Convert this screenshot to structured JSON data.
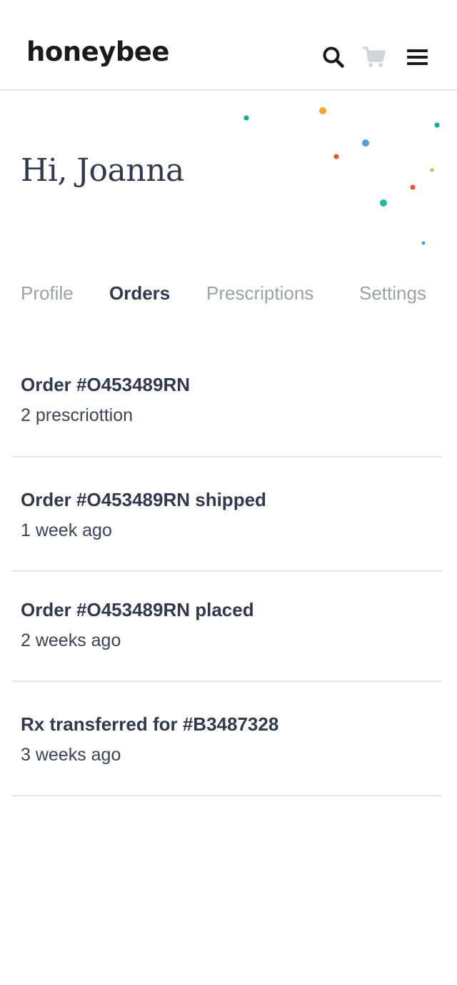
{
  "header": {
    "logo": "honeybee",
    "icons": [
      "search-icon",
      "cart-icon",
      "menu-icon"
    ]
  },
  "hero": {
    "greeting": "Hi, Joanna"
  },
  "tabs": [
    {
      "label": "Profile",
      "active": false
    },
    {
      "label": "Orders",
      "active": true
    },
    {
      "label": "Prescriptions",
      "active": false
    },
    {
      "label": "Settings",
      "active": false
    }
  ],
  "orders": [
    {
      "title": "Order #O453489RN",
      "subtitle": "2 prescriottion"
    },
    {
      "title": "Order #O453489RN shipped",
      "subtitle": "1 week ago"
    },
    {
      "title": "Order #O453489RN placed",
      "subtitle": "2 weeks ago"
    },
    {
      "title": "Rx transferred for #B3487328",
      "subtitle": "3 weeks ago"
    }
  ],
  "colors": {
    "text_primary": "#2f3a4f",
    "text_muted": "#9aa1ab",
    "divider": "#e3e6ea",
    "cart_icon": "#d3d5d8",
    "confetti": [
      "#12a89d",
      "#f5a623",
      "#5b9bd5",
      "#e8552b",
      "#1fb8a5"
    ]
  }
}
